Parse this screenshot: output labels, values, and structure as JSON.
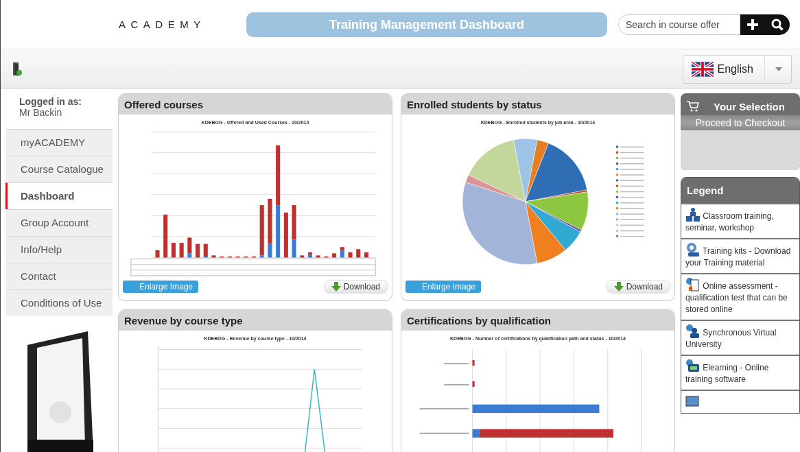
{
  "header": {
    "brand": "ACADEMY",
    "title": "Training Management Dashboard",
    "search": {
      "placeholder": "Search in course offer"
    }
  },
  "toolbar": {
    "language": "English"
  },
  "sidebar": {
    "logged_in_label": "Logged in as:",
    "user": "Mr Backin",
    "items": [
      {
        "label": "myACADEMY",
        "selected": false
      },
      {
        "label": "Course Catalogue",
        "selected": false
      },
      {
        "label": "Dashboard",
        "selected": true
      },
      {
        "label": "Group Account",
        "selected": false
      },
      {
        "label": "Info/Help",
        "selected": false
      },
      {
        "label": "Contact",
        "selected": false
      },
      {
        "label": "Conditions of Use",
        "selected": false
      }
    ]
  },
  "panels": [
    {
      "title": "Offered courses",
      "kind": "bar",
      "chart_title": "KDEBOG - Offered and Used Courses - 10/2014",
      "enlarge": "Enlarge Image",
      "download": "Download"
    },
    {
      "title": "Enrolled students by status",
      "kind": "pie",
      "chart_title": "KDEBOG - Enrolled students by job area - 10/2014",
      "enlarge": "Enlarge Image",
      "download": "Download"
    },
    {
      "title": "Revenue by course type",
      "kind": "line",
      "chart_title": "KDEBOG - Revenue by course type - 10/2014"
    },
    {
      "title": "Certifications by qualification",
      "kind": "hbar",
      "chart_title": "KDEBOG - Number of certifications by qualification path and status - 10/2014"
    }
  ],
  "selection": {
    "title": "Your Selection",
    "checkout": "Proceed to Checkout"
  },
  "legend": {
    "title": "Legend",
    "items": [
      {
        "kind": "classroom",
        "text": "Classroom training, seminar, workshop"
      },
      {
        "kind": "kit",
        "text": "Training kits - Download your Training material"
      },
      {
        "kind": "assessment",
        "text": "Online assessment - qualification test that can be stored online"
      },
      {
        "kind": "virtual",
        "text": "Synchronous Virtual University"
      },
      {
        "kind": "elearning",
        "text": "Elearning - Online training software"
      },
      {
        "kind": "device"
      }
    ]
  }
}
